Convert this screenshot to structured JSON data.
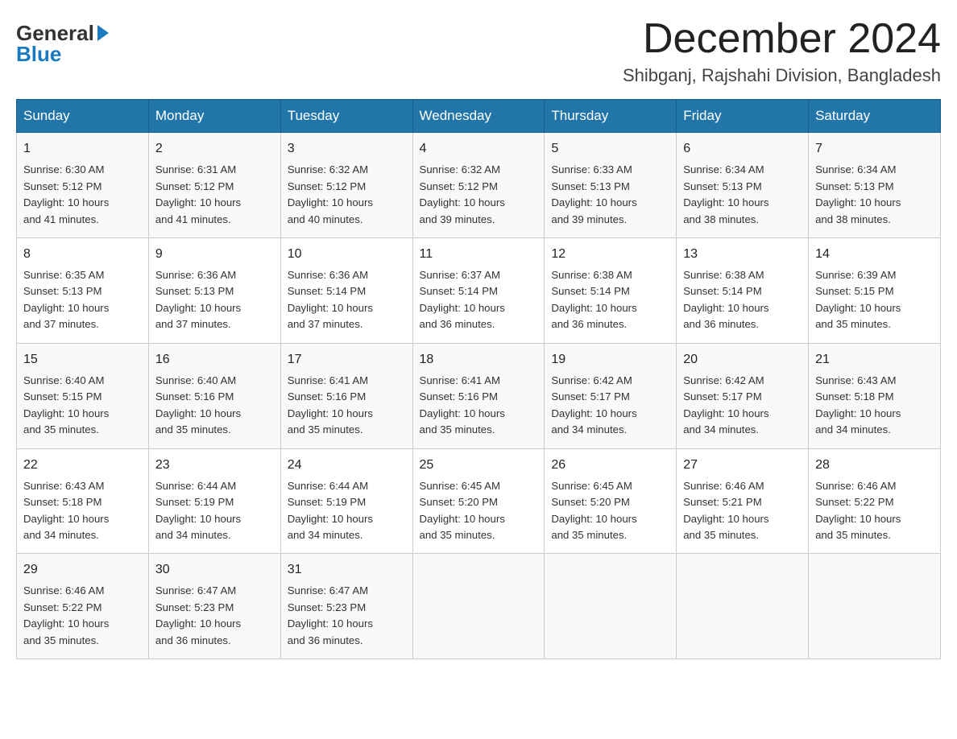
{
  "header": {
    "logo_general": "General",
    "logo_blue": "Blue",
    "main_title": "December 2024",
    "subtitle": "Shibganj, Rajshahi Division, Bangladesh"
  },
  "weekdays": [
    "Sunday",
    "Monday",
    "Tuesday",
    "Wednesday",
    "Thursday",
    "Friday",
    "Saturday"
  ],
  "weeks": [
    [
      {
        "day": "1",
        "info": "Sunrise: 6:30 AM\nSunset: 5:12 PM\nDaylight: 10 hours\nand 41 minutes."
      },
      {
        "day": "2",
        "info": "Sunrise: 6:31 AM\nSunset: 5:12 PM\nDaylight: 10 hours\nand 41 minutes."
      },
      {
        "day": "3",
        "info": "Sunrise: 6:32 AM\nSunset: 5:12 PM\nDaylight: 10 hours\nand 40 minutes."
      },
      {
        "day": "4",
        "info": "Sunrise: 6:32 AM\nSunset: 5:12 PM\nDaylight: 10 hours\nand 39 minutes."
      },
      {
        "day": "5",
        "info": "Sunrise: 6:33 AM\nSunset: 5:13 PM\nDaylight: 10 hours\nand 39 minutes."
      },
      {
        "day": "6",
        "info": "Sunrise: 6:34 AM\nSunset: 5:13 PM\nDaylight: 10 hours\nand 38 minutes."
      },
      {
        "day": "7",
        "info": "Sunrise: 6:34 AM\nSunset: 5:13 PM\nDaylight: 10 hours\nand 38 minutes."
      }
    ],
    [
      {
        "day": "8",
        "info": "Sunrise: 6:35 AM\nSunset: 5:13 PM\nDaylight: 10 hours\nand 37 minutes."
      },
      {
        "day": "9",
        "info": "Sunrise: 6:36 AM\nSunset: 5:13 PM\nDaylight: 10 hours\nand 37 minutes."
      },
      {
        "day": "10",
        "info": "Sunrise: 6:36 AM\nSunset: 5:14 PM\nDaylight: 10 hours\nand 37 minutes."
      },
      {
        "day": "11",
        "info": "Sunrise: 6:37 AM\nSunset: 5:14 PM\nDaylight: 10 hours\nand 36 minutes."
      },
      {
        "day": "12",
        "info": "Sunrise: 6:38 AM\nSunset: 5:14 PM\nDaylight: 10 hours\nand 36 minutes."
      },
      {
        "day": "13",
        "info": "Sunrise: 6:38 AM\nSunset: 5:14 PM\nDaylight: 10 hours\nand 36 minutes."
      },
      {
        "day": "14",
        "info": "Sunrise: 6:39 AM\nSunset: 5:15 PM\nDaylight: 10 hours\nand 35 minutes."
      }
    ],
    [
      {
        "day": "15",
        "info": "Sunrise: 6:40 AM\nSunset: 5:15 PM\nDaylight: 10 hours\nand 35 minutes."
      },
      {
        "day": "16",
        "info": "Sunrise: 6:40 AM\nSunset: 5:16 PM\nDaylight: 10 hours\nand 35 minutes."
      },
      {
        "day": "17",
        "info": "Sunrise: 6:41 AM\nSunset: 5:16 PM\nDaylight: 10 hours\nand 35 minutes."
      },
      {
        "day": "18",
        "info": "Sunrise: 6:41 AM\nSunset: 5:16 PM\nDaylight: 10 hours\nand 35 minutes."
      },
      {
        "day": "19",
        "info": "Sunrise: 6:42 AM\nSunset: 5:17 PM\nDaylight: 10 hours\nand 34 minutes."
      },
      {
        "day": "20",
        "info": "Sunrise: 6:42 AM\nSunset: 5:17 PM\nDaylight: 10 hours\nand 34 minutes."
      },
      {
        "day": "21",
        "info": "Sunrise: 6:43 AM\nSunset: 5:18 PM\nDaylight: 10 hours\nand 34 minutes."
      }
    ],
    [
      {
        "day": "22",
        "info": "Sunrise: 6:43 AM\nSunset: 5:18 PM\nDaylight: 10 hours\nand 34 minutes."
      },
      {
        "day": "23",
        "info": "Sunrise: 6:44 AM\nSunset: 5:19 PM\nDaylight: 10 hours\nand 34 minutes."
      },
      {
        "day": "24",
        "info": "Sunrise: 6:44 AM\nSunset: 5:19 PM\nDaylight: 10 hours\nand 34 minutes."
      },
      {
        "day": "25",
        "info": "Sunrise: 6:45 AM\nSunset: 5:20 PM\nDaylight: 10 hours\nand 35 minutes."
      },
      {
        "day": "26",
        "info": "Sunrise: 6:45 AM\nSunset: 5:20 PM\nDaylight: 10 hours\nand 35 minutes."
      },
      {
        "day": "27",
        "info": "Sunrise: 6:46 AM\nSunset: 5:21 PM\nDaylight: 10 hours\nand 35 minutes."
      },
      {
        "day": "28",
        "info": "Sunrise: 6:46 AM\nSunset: 5:22 PM\nDaylight: 10 hours\nand 35 minutes."
      }
    ],
    [
      {
        "day": "29",
        "info": "Sunrise: 6:46 AM\nSunset: 5:22 PM\nDaylight: 10 hours\nand 35 minutes."
      },
      {
        "day": "30",
        "info": "Sunrise: 6:47 AM\nSunset: 5:23 PM\nDaylight: 10 hours\nand 36 minutes."
      },
      {
        "day": "31",
        "info": "Sunrise: 6:47 AM\nSunset: 5:23 PM\nDaylight: 10 hours\nand 36 minutes."
      },
      {
        "day": "",
        "info": ""
      },
      {
        "day": "",
        "info": ""
      },
      {
        "day": "",
        "info": ""
      },
      {
        "day": "",
        "info": ""
      }
    ]
  ]
}
